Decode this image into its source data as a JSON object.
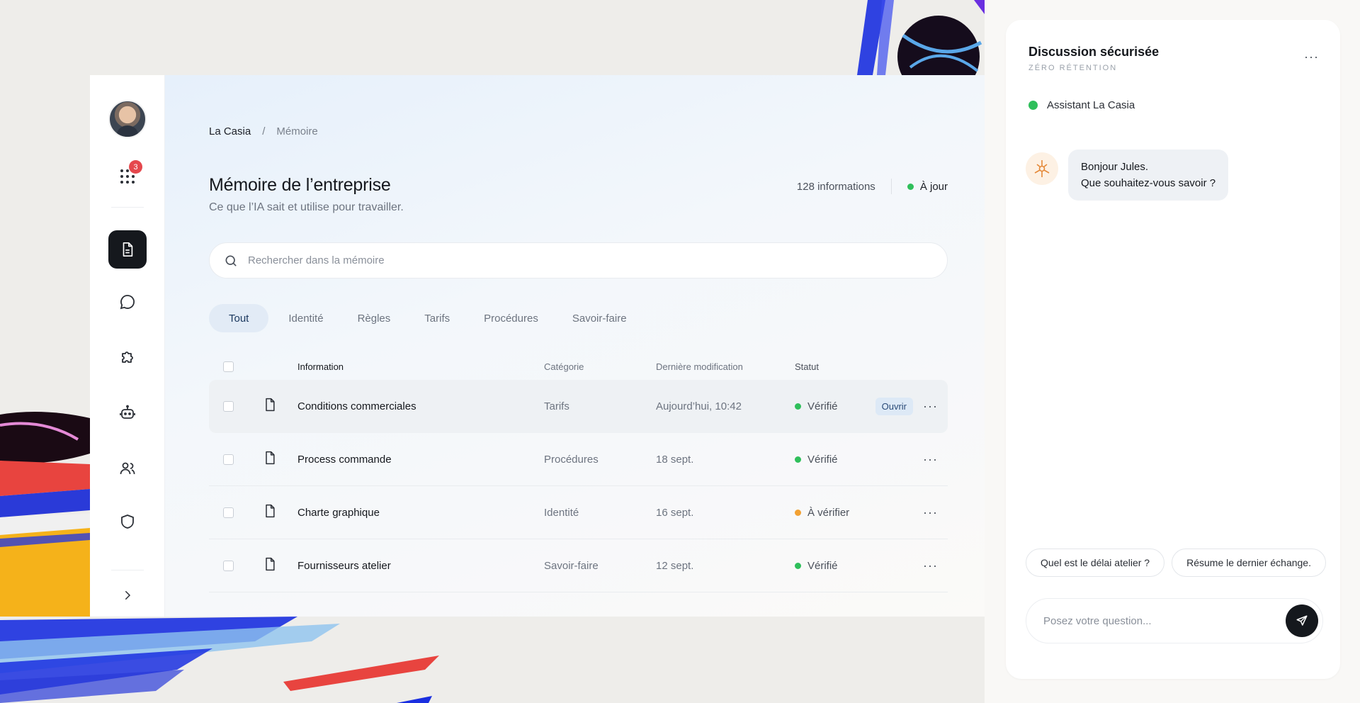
{
  "breadcrumb": {
    "root": "La Casia",
    "separator": "/",
    "current": "Mémoire"
  },
  "header": {
    "title": "Mémoire de l’entreprise",
    "subtitle": "Ce que l’IA sait et utilise pour travailler.",
    "count": "128 informations",
    "status": "À jour"
  },
  "rail": {
    "badge_count": "3",
    "icons": [
      "apps-grid-icon",
      "document-icon",
      "chat-icon",
      "puzzle-icon",
      "robot-icon",
      "users-icon",
      "shield-icon",
      "chevron-right-icon"
    ]
  },
  "search": {
    "placeholder": "Rechercher dans la mémoire"
  },
  "tabs": [
    {
      "label": "Tout",
      "active": true
    },
    {
      "label": "Identité"
    },
    {
      "label": "Règles"
    },
    {
      "label": "Tarifs"
    },
    {
      "label": "Procédures"
    },
    {
      "label": "Savoir-faire"
    }
  ],
  "table": {
    "columns": [
      "Information",
      "Catégorie",
      "Dernière modification",
      "Statut"
    ],
    "open_label": "Ouvrir",
    "rows": [
      {
        "info": "Conditions commerciales",
        "category": "Tarifs",
        "date": "Aujourd’hui, 10:42",
        "status": "Vérifié",
        "status_color": "#2fbf5b"
      },
      {
        "info": "Process commande",
        "category": "Procédures",
        "date": "18 sept.",
        "status": "Vérifié",
        "status_color": "#2fbf5b"
      },
      {
        "info": "Charte graphique",
        "category": "Identité",
        "date": "16 sept.",
        "status": "À vérifier",
        "status_color": "#f2a133"
      },
      {
        "info": "Fournisseurs atelier",
        "category": "Savoir-faire",
        "date": "12 sept.",
        "status": "Vérifié",
        "status_color": "#2fbf5b"
      }
    ]
  },
  "chat": {
    "title": "Discussion sécurisée",
    "subtitle": "ZÉRO RÉTENTION",
    "assistant_name": "Assistant La Casia",
    "messages": [
      {
        "line1": "Bonjour Jules.",
        "line2": "Que souhaitez-vous savoir ?"
      }
    ],
    "suggestions": [
      "Quel est le délai atelier ?",
      "Résume le dernier échange."
    ],
    "input_placeholder": "Posez votre question..."
  },
  "colors": {
    "accent_dark": "#15181d",
    "success": "#2fbf5b",
    "warning": "#f2a133",
    "badge": "#e5484d"
  }
}
